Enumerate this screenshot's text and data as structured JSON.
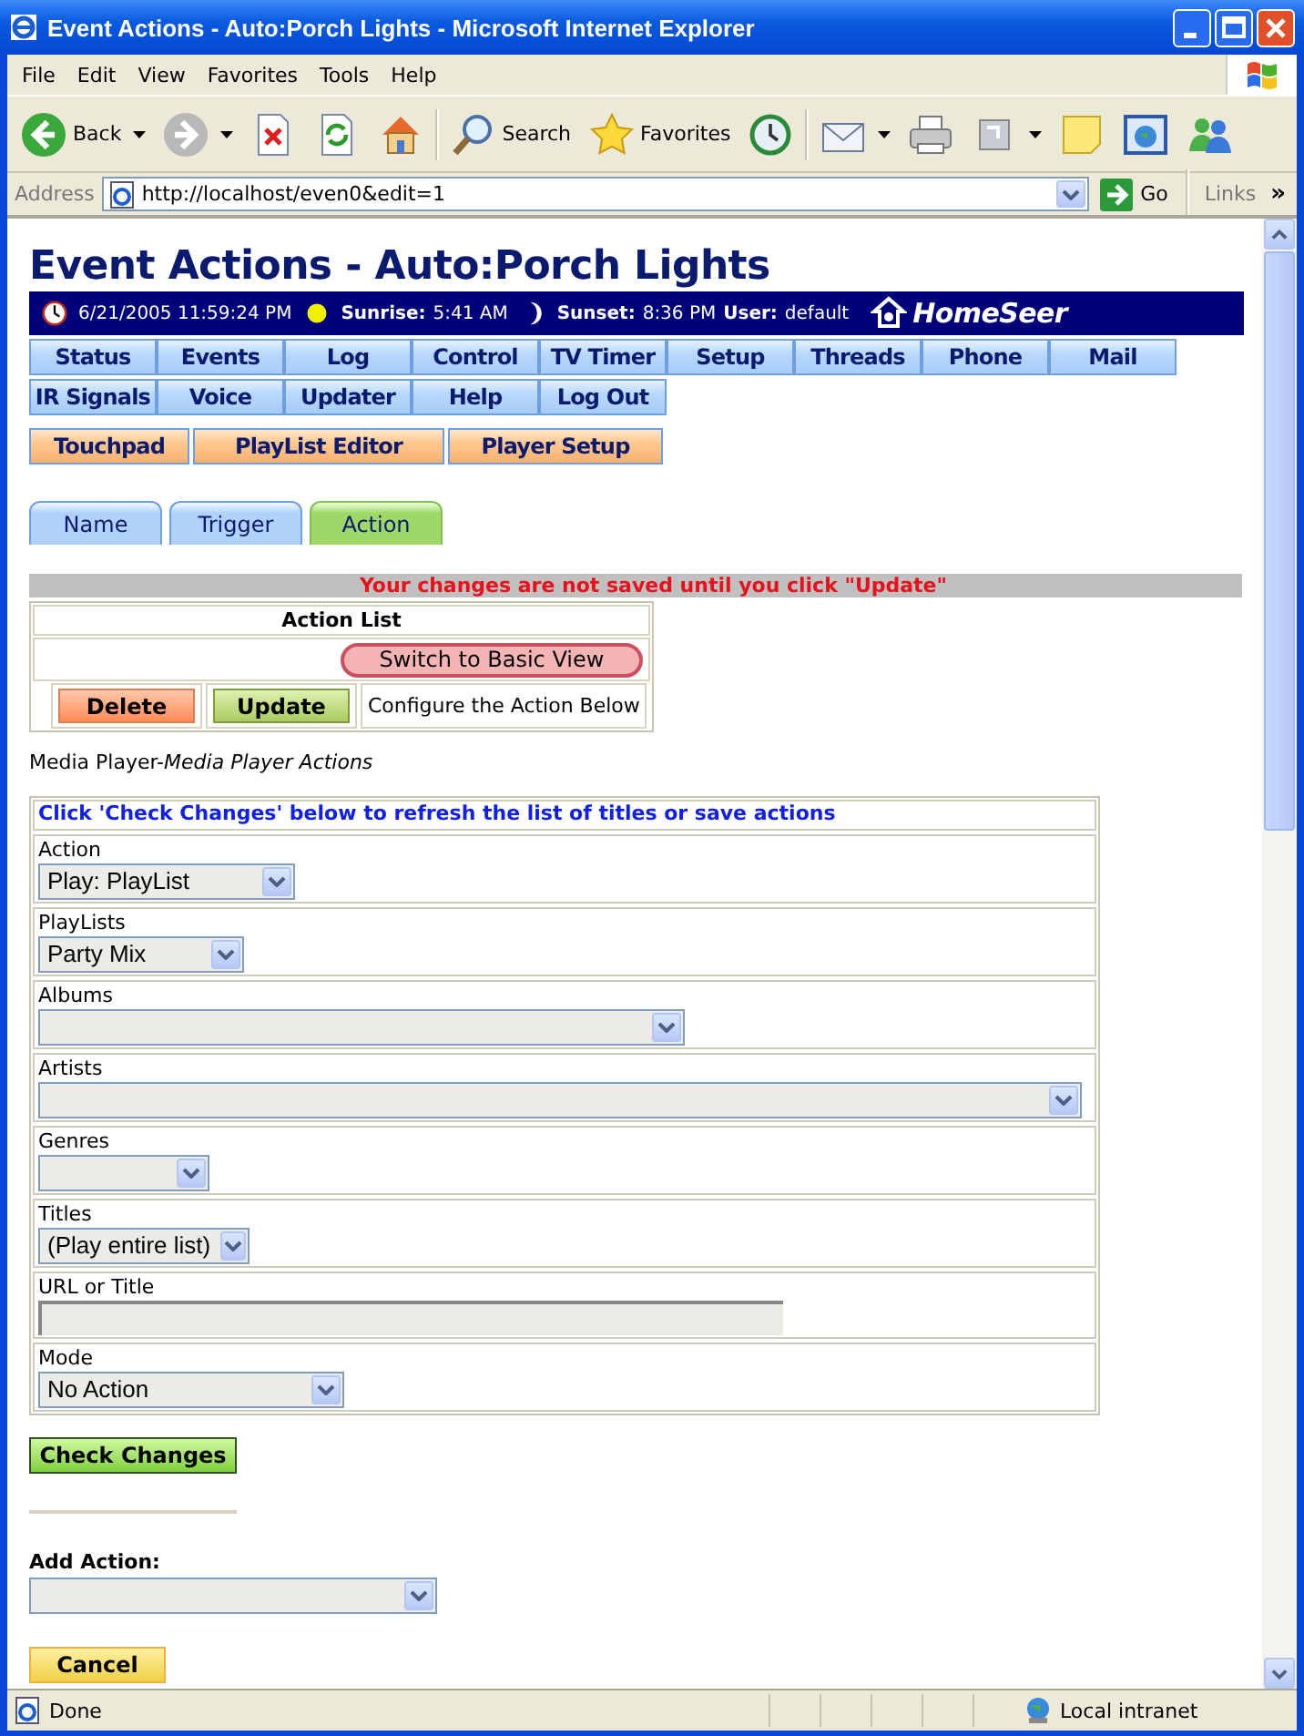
{
  "window": {
    "title": "Event Actions - Auto:Porch Lights - Microsoft Internet Explorer"
  },
  "menu": [
    "File",
    "Edit",
    "View",
    "Favorites",
    "Tools",
    "Help"
  ],
  "toolbar": [
    {
      "kind": "back",
      "label": "Back",
      "dropdown": true
    },
    {
      "kind": "forward",
      "dropdown": true
    },
    {
      "kind": "stop"
    },
    {
      "kind": "refresh"
    },
    {
      "kind": "home"
    },
    {
      "kind": "search",
      "label": "Search"
    },
    {
      "kind": "favorites",
      "label": "Favorites"
    },
    {
      "kind": "history"
    },
    {
      "kind": "mail",
      "dropdown": true
    },
    {
      "kind": "print"
    },
    {
      "kind": "edit",
      "dropdown": true
    },
    {
      "kind": "note"
    },
    {
      "kind": "media"
    },
    {
      "kind": "messenger"
    }
  ],
  "address": {
    "label": "Address",
    "value": "http://localhost/even0&edit=1",
    "go": "Go",
    "links": "Links",
    "chevron": "»"
  },
  "page": {
    "heading": "Event Actions - Auto:Porch Lights",
    "info": {
      "date": "6/21/2005 11:59:24 PM",
      "sunrise_label": "Sunrise:",
      "sunrise": "5:41 AM",
      "sunset_label": "Sunset:",
      "sunset": "8:36 PM",
      "user_label": "User:",
      "user": "default",
      "logo": "HomeSeer"
    },
    "nav_rows": [
      [
        "Status",
        "Events",
        "Log",
        "Control",
        "TV Timer",
        "Setup",
        "Threads",
        "Phone",
        "Mail"
      ],
      [
        "IR Signals",
        "Voice",
        "Updater",
        "Help",
        "Log Out"
      ]
    ],
    "plugin_buttons": [
      "Touchpad",
      "PlayList Editor",
      "Player Setup"
    ],
    "tabs": [
      {
        "label": "Name",
        "selected": false
      },
      {
        "label": "Trigger",
        "selected": false
      },
      {
        "label": "Action",
        "selected": true
      }
    ],
    "notice": "Your changes are not saved until you click \"Update\"",
    "action_list": {
      "title": "Action List",
      "switch_button": "Switch to Basic View",
      "delete": "Delete",
      "update": "Update",
      "hint": "Configure the Action Below"
    },
    "plugin_line": "Media Player-*Media Player Actions*",
    "form": {
      "instruction": "Click 'Check Changes' below to refresh the list of titles or save actions",
      "fields": [
        {
          "label": "Action",
          "kind": "select",
          "value": "Play: PlayList"
        },
        {
          "label": "PlayLists",
          "kind": "select",
          "value": "Party Mix"
        },
        {
          "label": "Albums",
          "kind": "select"
        },
        {
          "label": "Artists",
          "kind": "select"
        },
        {
          "label": "Genres",
          "kind": "select"
        },
        {
          "label": "Titles",
          "kind": "select",
          "value": "(Play entire list)"
        },
        {
          "label": "URL or Title",
          "kind": "text"
        },
        {
          "label": "Mode",
          "kind": "select",
          "value": "No Action"
        }
      ]
    },
    "check_button": "Check Changes",
    "add_action_label": "Add Action:",
    "cancel": "Cancel"
  },
  "status_bar": {
    "text": "Done",
    "zone": "Local intranet"
  }
}
